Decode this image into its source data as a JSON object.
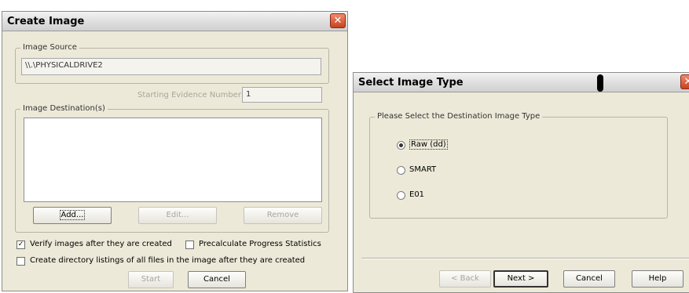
{
  "create_image": {
    "title": "Create Image",
    "close_glyph": "✕",
    "source_label": "Image Source",
    "source_value": "\\\\.\\PHYSICALDRIVE2",
    "evidence_label": "Starting Evidence Number:",
    "evidence_value": "1",
    "destination_label": "Image Destination(s)",
    "add_label": "Add...",
    "edit_label": "Edit...",
    "remove_label": "Remove",
    "verify_label": "Verify images after they are created",
    "verify_checked": "✓",
    "precalc_label": "Precalculate Progress Statistics",
    "dirlist_label": "Create directory listings of all files in the image after they are created",
    "start_label": "Start",
    "cancel_label": "Cancel"
  },
  "select_type": {
    "title": "Select Image Type",
    "close_glyph": "✕",
    "group_label": "Please Select the Destination Image Type",
    "options": [
      {
        "label": "Raw (dd)",
        "selected": true
      },
      {
        "label": "SMART",
        "selected": false
      },
      {
        "label": "E01",
        "selected": false
      }
    ],
    "back_label": "< Back",
    "next_label": "Next >",
    "cancel_label": "Cancel",
    "help_label": "Help"
  }
}
